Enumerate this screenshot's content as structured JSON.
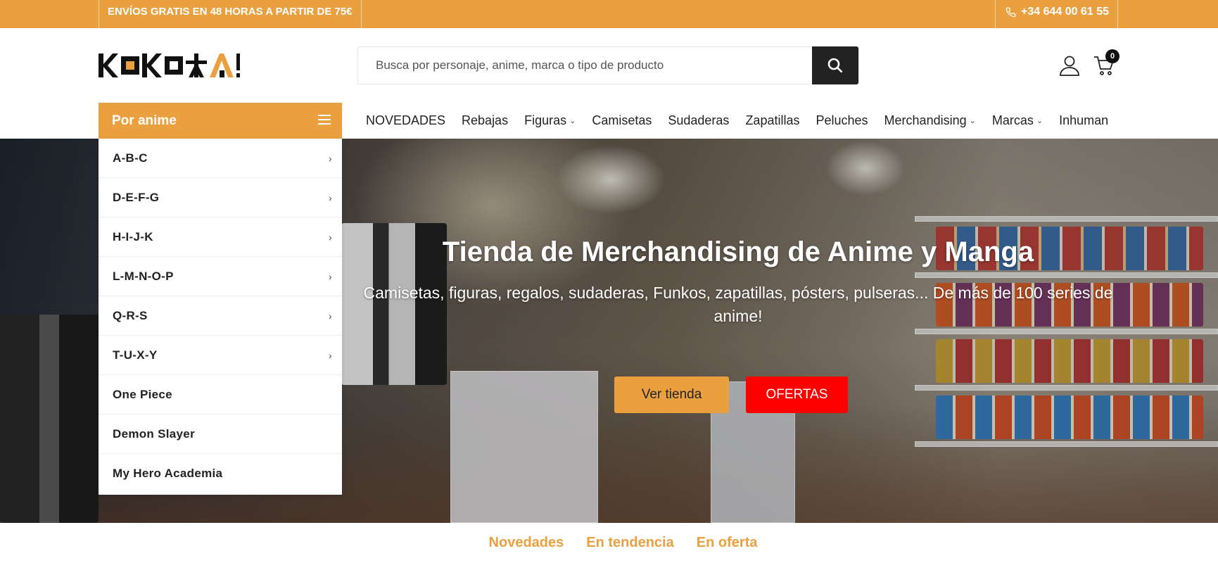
{
  "topbar": {
    "promo": "ENVÍOS GRATIS EN 48 HORAS A PARTIR DE 75€",
    "phone": "+34 644 00 61 55"
  },
  "header": {
    "logo_text": "KOKOKAI",
    "search_placeholder": "Busca por personaje, anime, marca o tipo de producto",
    "cart_count": "0"
  },
  "category_menu": {
    "label": "Por anime",
    "items": [
      {
        "label": "A-B-C",
        "has_submenu": true
      },
      {
        "label": "D-E-F-G",
        "has_submenu": true
      },
      {
        "label": "H-I-J-K",
        "has_submenu": true
      },
      {
        "label": "L-M-N-O-P",
        "has_submenu": true
      },
      {
        "label": "Q-R-S",
        "has_submenu": true
      },
      {
        "label": "T-U-X-Y",
        "has_submenu": true
      },
      {
        "label": "One Piece",
        "has_submenu": false
      },
      {
        "label": "Demon Slayer",
        "has_submenu": false
      },
      {
        "label": "My Hero Academia",
        "has_submenu": false
      }
    ]
  },
  "nav": {
    "items": [
      {
        "label": "NOVEDADES",
        "dropdown": false
      },
      {
        "label": "Rebajas",
        "dropdown": false
      },
      {
        "label": "Figuras",
        "dropdown": true
      },
      {
        "label": "Camisetas",
        "dropdown": false
      },
      {
        "label": "Sudaderas",
        "dropdown": false
      },
      {
        "label": "Zapatillas",
        "dropdown": false
      },
      {
        "label": "Peluches",
        "dropdown": false
      },
      {
        "label": "Merchandising",
        "dropdown": true
      },
      {
        "label": "Marcas",
        "dropdown": true
      },
      {
        "label": "Inhuman",
        "dropdown": false
      }
    ]
  },
  "hero": {
    "title": "Tienda de Merchandising de Anime y Manga",
    "subtitle": "Camisetas, figuras, regalos, sudaderas, Funkos, zapatillas, pósters, pulseras... De más de 100 series de anime!",
    "primary_button": "Ver tienda",
    "secondary_button": "OFERTAS"
  },
  "product_tabs": [
    "Novedades",
    "En tendencia",
    "En oferta"
  ],
  "colors": {
    "accent": "#EBA03F",
    "offer": "#FF0000",
    "dark": "#222222"
  },
  "icons": [
    "phone-icon",
    "search-icon",
    "user-icon",
    "cart-icon",
    "hamburger-icon",
    "chevron-right-icon",
    "chevron-down-icon"
  ]
}
